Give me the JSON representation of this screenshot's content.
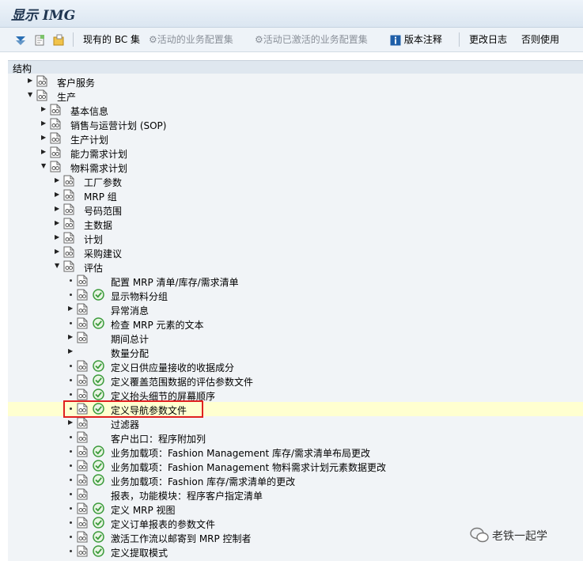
{
  "window": {
    "title": "显示 IMG"
  },
  "toolbar": {
    "bc_set": "现有的 BC 集",
    "active_config": "活动的业务配置集",
    "activated_config": "活动已激活的业务配置集",
    "release_notes": "版本注释",
    "change_log": "更改日志",
    "whether_used": "否则使用"
  },
  "tree_header": "结构",
  "tree": [
    {
      "label": "客户服务",
      "level": 0,
      "toggle": "collapsed"
    },
    {
      "label": "生产",
      "level": 0,
      "toggle": "expanded"
    },
    {
      "label": "基本信息",
      "level": 1,
      "toggle": "collapsed"
    },
    {
      "label": "销售与运营计划 (SOP)",
      "level": 1,
      "toggle": "collapsed"
    },
    {
      "label": "生产计划",
      "level": 1,
      "toggle": "collapsed"
    },
    {
      "label": "能力需求计划",
      "level": 1,
      "toggle": "collapsed"
    },
    {
      "label": "物料需求计划",
      "level": 1,
      "toggle": "expanded"
    },
    {
      "label": "工厂参数",
      "level": 2,
      "toggle": "collapsed"
    },
    {
      "label": "MRP 组",
      "level": 2,
      "toggle": "collapsed"
    },
    {
      "label": "号码范围",
      "level": 2,
      "toggle": "collapsed"
    },
    {
      "label": "主数据",
      "level": 2,
      "toggle": "collapsed"
    },
    {
      "label": "计划",
      "level": 2,
      "toggle": "collapsed"
    },
    {
      "label": "采购建议",
      "level": 2,
      "toggle": "collapsed"
    },
    {
      "label": "评估",
      "level": 2,
      "toggle": "expanded"
    },
    {
      "label": "配置 MRP 清单/库存/需求清单",
      "level": 3,
      "toggle": "leaf",
      "doc": true,
      "exec": false
    },
    {
      "label": "显示物料分组",
      "level": 3,
      "toggle": "leaf",
      "doc": true,
      "exec": true
    },
    {
      "label": "异常消息",
      "level": 3,
      "toggle": "collapsed",
      "doc": true,
      "exec": false
    },
    {
      "label": "检查 MRP 元素的文本",
      "level": 3,
      "toggle": "leaf",
      "doc": true,
      "exec": true
    },
    {
      "label": "期间总计",
      "level": 3,
      "toggle": "collapsed",
      "doc": true,
      "exec": false
    },
    {
      "label": "数量分配",
      "level": 3,
      "toggle": "collapsed",
      "doc": false,
      "exec": false
    },
    {
      "label": "定义日供应量接收的收据成分",
      "level": 3,
      "toggle": "leaf",
      "doc": true,
      "exec": true
    },
    {
      "label": "定义覆盖范围数据的评估参数文件",
      "level": 3,
      "toggle": "leaf",
      "doc": true,
      "exec": true
    },
    {
      "label": "定义抬头细节的屏幕顺序",
      "level": 3,
      "toggle": "leaf",
      "doc": true,
      "exec": true
    },
    {
      "label": "定义导航参数文件",
      "level": 3,
      "toggle": "leaf",
      "doc": true,
      "exec": true,
      "highlight": true
    },
    {
      "label": "过滤器",
      "level": 3,
      "toggle": "collapsed",
      "doc": true,
      "exec": false
    },
    {
      "label": "客户出口：程序附加列",
      "level": 3,
      "toggle": "leaf",
      "doc": true,
      "exec": false
    },
    {
      "label": "业务加载项：Fashion Management 库存/需求清单布局更改",
      "level": 3,
      "toggle": "leaf",
      "doc": true,
      "exec": true
    },
    {
      "label": "业务加载项：Fashion Management 物料需求计划元素数据更改",
      "level": 3,
      "toggle": "leaf",
      "doc": true,
      "exec": true
    },
    {
      "label": "业务加载项：Fashion 库存/需求清单的更改",
      "level": 3,
      "toggle": "leaf",
      "doc": true,
      "exec": true
    },
    {
      "label": "报表，功能模块：程序客户指定清单",
      "level": 3,
      "toggle": "leaf",
      "doc": true,
      "exec": false
    },
    {
      "label": "定义 MRP 视图",
      "level": 3,
      "toggle": "leaf",
      "doc": true,
      "exec": true
    },
    {
      "label": "定义订单报表的参数文件",
      "level": 3,
      "toggle": "leaf",
      "doc": true,
      "exec": true
    },
    {
      "label": "激活工作流以邮寄到 MRP 控制者",
      "level": 3,
      "toggle": "leaf",
      "doc": true,
      "exec": true
    },
    {
      "label": "定义提取模式",
      "level": 3,
      "toggle": "leaf",
      "doc": true,
      "exec": true
    }
  ],
  "watermark": "老铁一起学",
  "colors": {
    "highlight": "#ffffd0",
    "red_box": "#e02020",
    "exec_icon": "#3a9a3a"
  }
}
